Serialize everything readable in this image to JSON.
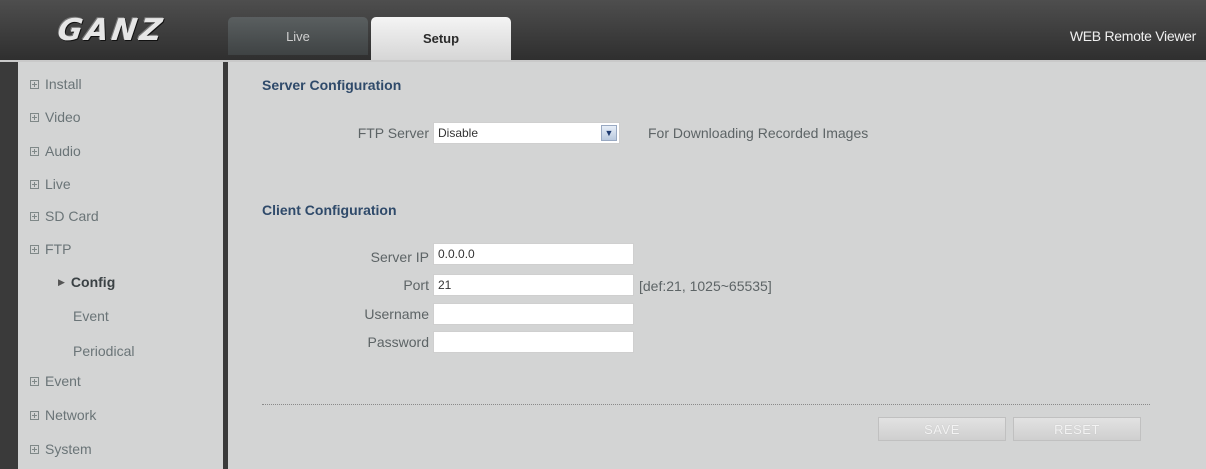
{
  "header": {
    "logo_text": "GANZ",
    "tabs": [
      {
        "label": "Live"
      },
      {
        "label": "Setup"
      }
    ],
    "viewer_title": "WEB Remote Viewer"
  },
  "sidebar": {
    "items": [
      {
        "label": "Install"
      },
      {
        "label": "Video"
      },
      {
        "label": "Audio"
      },
      {
        "label": "Live"
      },
      {
        "label": "SD Card"
      },
      {
        "label": "FTP"
      },
      {
        "label": "Event"
      },
      {
        "label": "Network"
      },
      {
        "label": "System"
      }
    ],
    "ftp_subitems": [
      {
        "label": "Config",
        "active": true
      },
      {
        "label": "Event"
      },
      {
        "label": "Periodical"
      }
    ]
  },
  "main": {
    "server_section_title": "Server Configuration",
    "ftp_server_label": "FTP Server",
    "ftp_server_value": "Disable",
    "ftp_server_hint": "For Downloading Recorded Images",
    "client_section_title": "Client Configuration",
    "server_ip_label": "Server IP",
    "server_ip_value": "0.0.0.0",
    "port_label": "Port",
    "port_value": "21",
    "port_hint": "[def:21, 1025~65535]",
    "username_label": "Username",
    "username_value": "",
    "password_label": "Password",
    "password_value": "",
    "save_label": "SAVE",
    "reset_label": "RESET"
  },
  "colors": {
    "panel_bg": "#d3d4d4",
    "section_title": "#2f4a6a",
    "header_bg": "#3a3a3a"
  }
}
